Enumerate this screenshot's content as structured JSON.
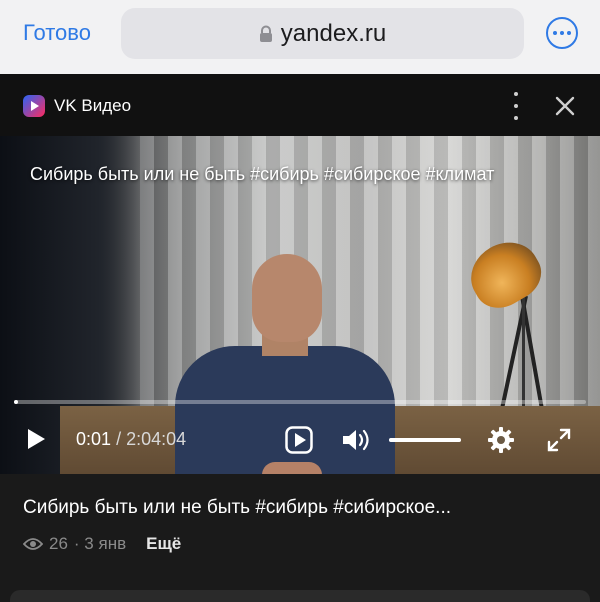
{
  "browser": {
    "done_label": "Готово",
    "url": "yandex.ru"
  },
  "player": {
    "app_name": "VK Видео",
    "caption": "Сибирь быть или не быть #сибирь #сибирское #климат",
    "current_time": "0:01",
    "duration": "/ 2:04:04",
    "progress_fraction": 0.0,
    "volume_fraction": 1.0
  },
  "video_info": {
    "title": "Сибирь быть или не быть #сибирь #сибирское...",
    "views": "26",
    "date": "· 3 янв",
    "more_label": "Ещё"
  },
  "colors": {
    "accent": "#2f7ae5",
    "sheet_bg": "#1a1a1a"
  }
}
